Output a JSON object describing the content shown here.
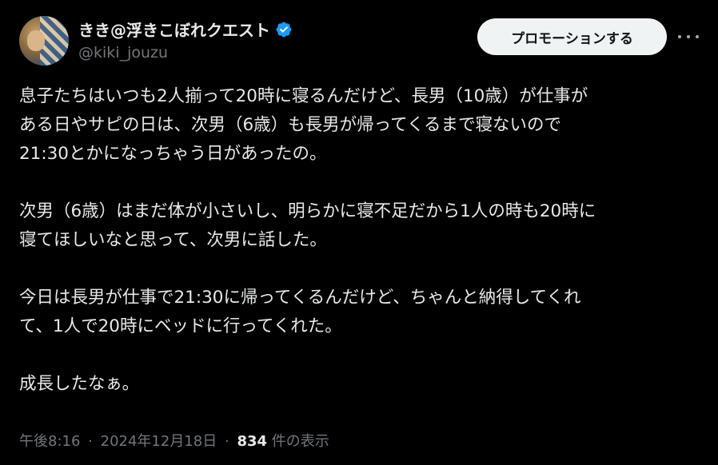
{
  "author": {
    "display_name": "きき@浮きこぼれクエスト",
    "handle": "@kiki_jouzu",
    "verified_icon": "verified-badge-icon",
    "verified_color": "#1d9bf0"
  },
  "actions": {
    "promote_label": "プロモーションする",
    "more_icon": "more-horizontal-icon"
  },
  "body": {
    "p1": [
      "息子たちはいつも2人揃って20時に寝るんだけど、長男（10歳）が仕事が",
      "ある日やサピの日は、次男（6歳）も長男が帰ってくるまで寝ないので",
      "21:30とかになっちゃう日があったの。"
    ],
    "p2": [
      "次男（6歳）はまだ体が小さいし、明らかに寝不足だから1人の時も20時に",
      "寝てほしいなと思って、次男に話した。"
    ],
    "p3": [
      "今日は長男が仕事で21:30に帰ってくるんだけど、ちゃんと納得してくれ",
      "て、1人で20時にベッドに行ってくれた。"
    ],
    "p4": [
      "成長したなぁ。"
    ]
  },
  "meta": {
    "time": "午後8:16",
    "date": "2024年12月18日",
    "separator": "·",
    "views_count": "834",
    "views_label": "件の表示"
  },
  "colors": {
    "background": "#000000",
    "text_primary": "#e7e9ea",
    "text_secondary": "#71767b",
    "button_bg": "#eff3f4"
  }
}
